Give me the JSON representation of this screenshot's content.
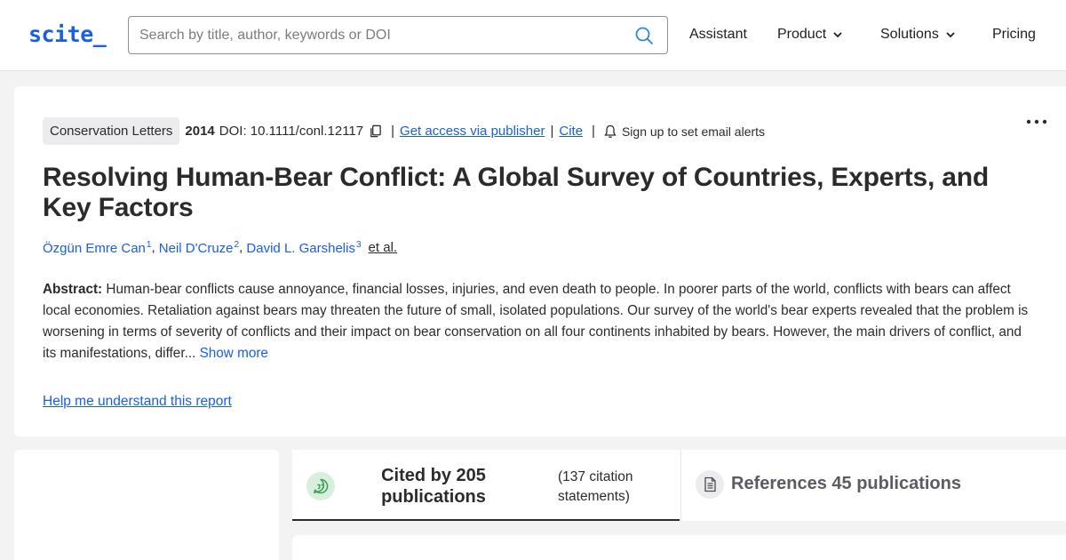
{
  "header": {
    "logo": "scite_",
    "search_placeholder": "Search by title, author, keywords or DOI",
    "nav": [
      {
        "label": "Assistant",
        "dropdown": false
      },
      {
        "label": "Product",
        "dropdown": true
      },
      {
        "label": "Solutions",
        "dropdown": true
      },
      {
        "label": "Pricing",
        "dropdown": false
      }
    ]
  },
  "article": {
    "journal": "Conservation Letters",
    "year": "2014",
    "doi": "DOI: 10.1111/conl.12117",
    "access_link": "Get access via publisher",
    "cite_link": "Cite",
    "alert_text": "Sign up to set email alerts",
    "title": "Resolving Human-Bear Conflict: A Global Survey of Countries, Experts, and Key Factors",
    "authors": [
      {
        "name": "Özgün Emre Can",
        "sup": "1"
      },
      {
        "name": "Neil D'Cruze",
        "sup": "2"
      },
      {
        "name": "David L. Garshelis",
        "sup": "3"
      }
    ],
    "et_al": "et al.",
    "abstract_label": "Abstract:",
    "abstract_text": "Human-bear conflicts cause annoyance, financial losses, injuries, and even death to people. In poorer parts of the world, conflicts with bears can affect local economies. Retaliation against bears may threaten the future of small, isolated populations. Our survey of the world's bear experts revealed that the problem is worsening in terms of severity of conflicts and their impact on bear conservation on all four continents inhabited by bears. However, the main drivers of conflict, and its manifestations, differ...",
    "show_more": "Show more",
    "help_link": "Help me understand this report"
  },
  "tabs": {
    "cited_label": "Cited by 205 publications",
    "cited_statements": "(137 citation statements)",
    "references_label": "References 45 publications"
  },
  "colors": {
    "accent": "#1a5ee5",
    "text": "#2b2b2b",
    "background": "#f3f3f4",
    "citation_green": "#3aa35b"
  }
}
